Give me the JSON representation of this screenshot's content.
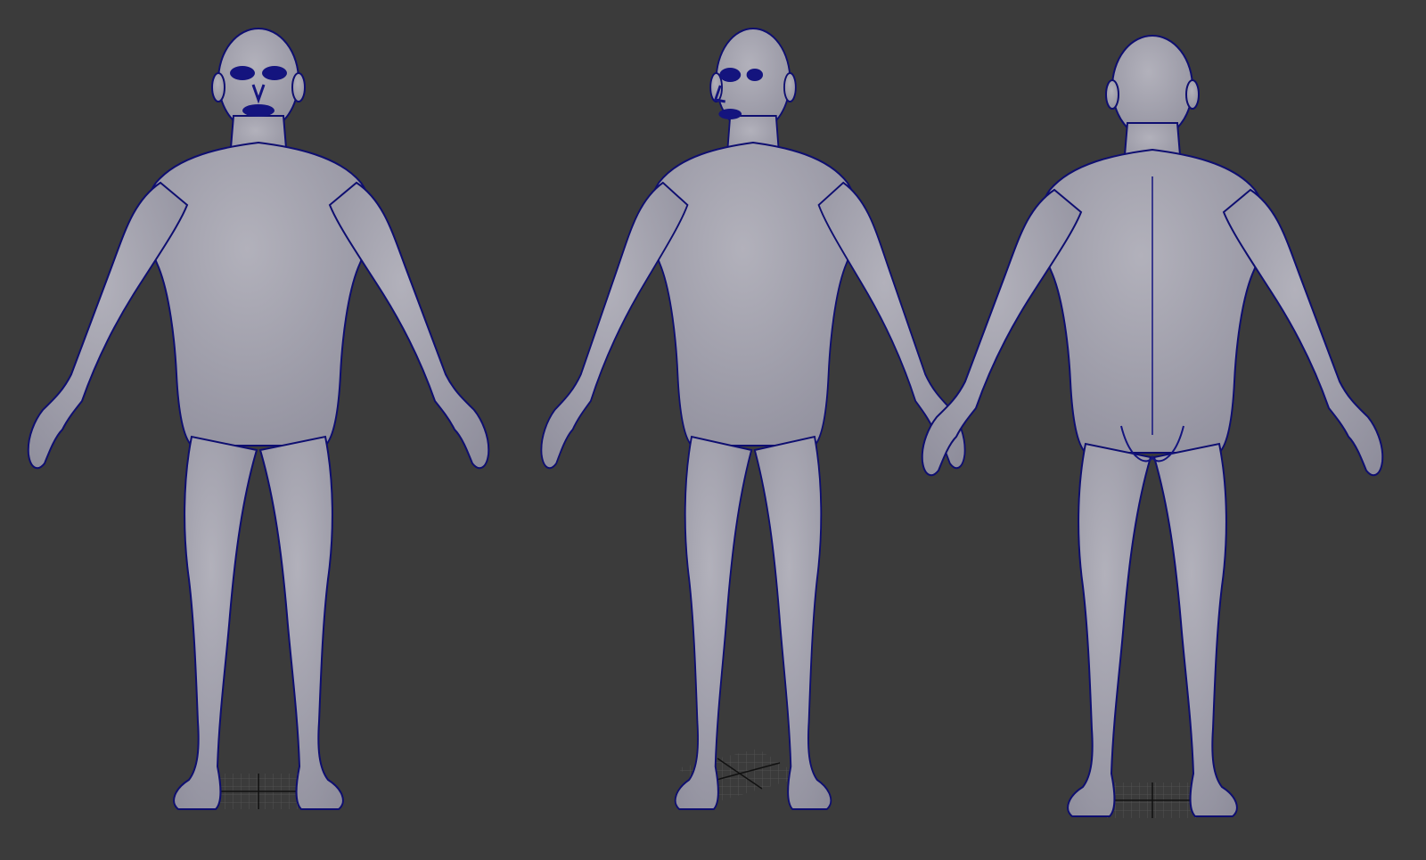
{
  "scene": {
    "background_color": "#3b3b3b",
    "mesh_fill_color": "#a6a5b0",
    "mesh_shade_color": "#8d8c9c",
    "wire_color": "#1a1a8c",
    "wire_dense_color": "#10107a",
    "ground_grid_color": "#5a5a5a",
    "ground_axis_color": "#111111",
    "views": [
      {
        "name": "front",
        "shows_face": true,
        "turn": "none"
      },
      {
        "name": "three-quarter",
        "shows_face": true,
        "turn": "right"
      },
      {
        "name": "back",
        "shows_face": false,
        "turn": "none"
      }
    ]
  }
}
